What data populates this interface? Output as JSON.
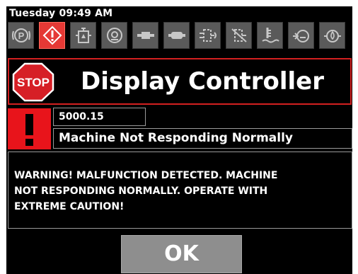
{
  "status_bar": {
    "datetime": "Tuesday 09:49 AM"
  },
  "icon_bar": {
    "icons": [
      {
        "name": "parking-brake-icon",
        "active": false
      },
      {
        "name": "warning-alert-icon",
        "active": true
      },
      {
        "name": "fluid-tank-icon",
        "active": false
      },
      {
        "name": "engine-block-icon",
        "active": false
      },
      {
        "name": "hydraulic-cylinder-icon",
        "active": false
      },
      {
        "name": "piston-icon",
        "active": false
      },
      {
        "name": "filter-flow-icon",
        "active": false
      },
      {
        "name": "filter-clogged-icon",
        "active": false
      },
      {
        "name": "coolant-level-icon",
        "active": false
      },
      {
        "name": "oil-pressure-icon",
        "active": false
      },
      {
        "name": "oil-drop-icon",
        "active": false
      }
    ],
    "colors": {
      "inactive": "#5a5a5a",
      "active": "#e53935"
    }
  },
  "header": {
    "stop_label": "STOP",
    "title": "Display Controller"
  },
  "alert": {
    "code": "5000.15",
    "message": "Machine Not Responding Normally"
  },
  "warning": {
    "text": "WARNING! MALFUNCTION DETECTED. MACHINE\nNOT RESPONDING NORMALLY.  OPERATE WITH\nEXTREME CAUTION!"
  },
  "actions": {
    "ok_label": "OK"
  }
}
